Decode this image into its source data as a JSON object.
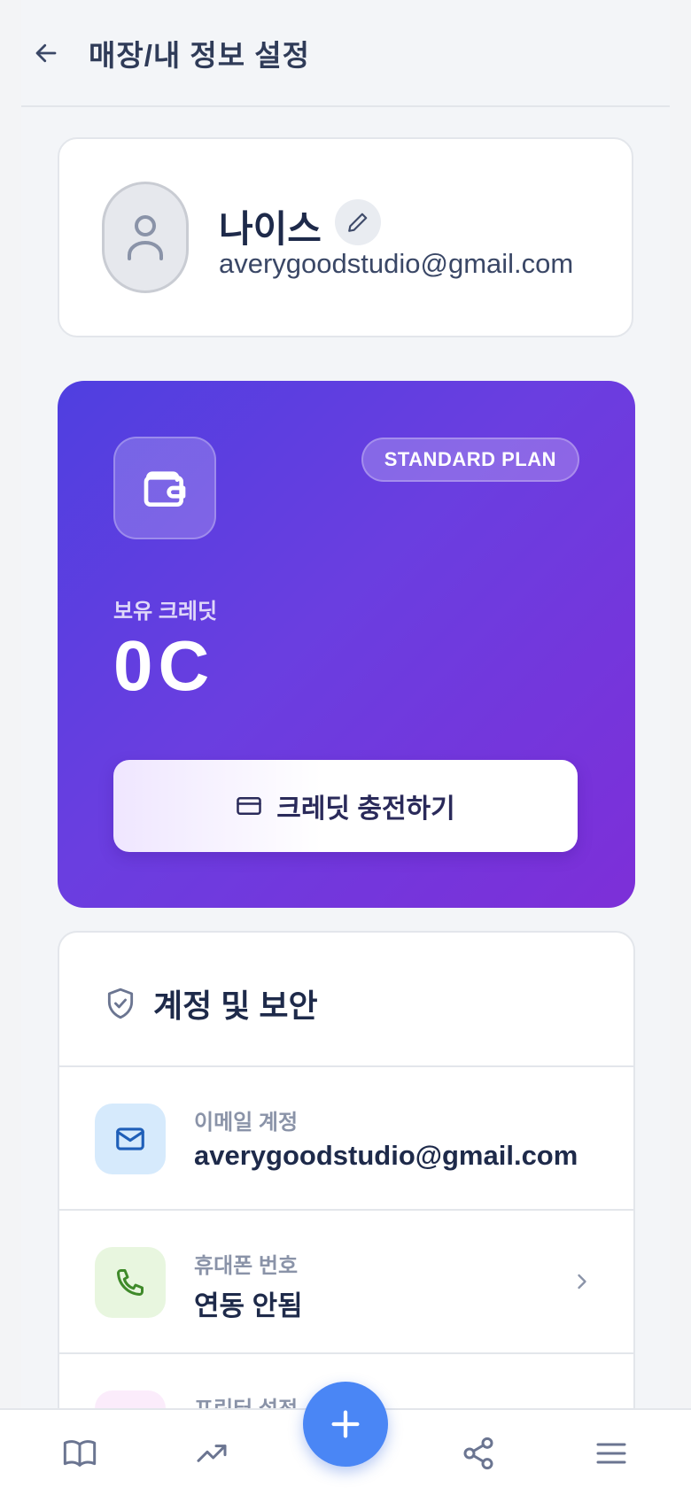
{
  "header": {
    "title": "매장/내 정보 설정"
  },
  "profile": {
    "name": "나이스",
    "email": "averygoodstudio@gmail.com"
  },
  "credit": {
    "plan_badge": "STANDARD PLAN",
    "label": "보유 크레딧",
    "amount": "0C",
    "charge_button": "크레딧 충전하기"
  },
  "security": {
    "title": "계정 및 보안",
    "rows": [
      {
        "label": "이메일 계정",
        "value": "averygoodstudio@gmail.com",
        "icon": "mail-icon",
        "color": "#d6eafc"
      },
      {
        "label": "휴대폰 번호",
        "value": "연동 안됨",
        "icon": "phone-icon",
        "color": "#e8f6df"
      },
      {
        "label": "프린터 설정",
        "value": "",
        "icon": "printer-icon",
        "color": "#fbecfb"
      }
    ]
  },
  "nav": {
    "items": [
      "book-icon",
      "trending-icon",
      "add-icon",
      "share-icon",
      "menu-icon"
    ]
  },
  "colors": {
    "accent": "#4a86f5",
    "credit_gradient_start": "#4f3fe0",
    "credit_gradient_end": "#7d2fd8"
  }
}
